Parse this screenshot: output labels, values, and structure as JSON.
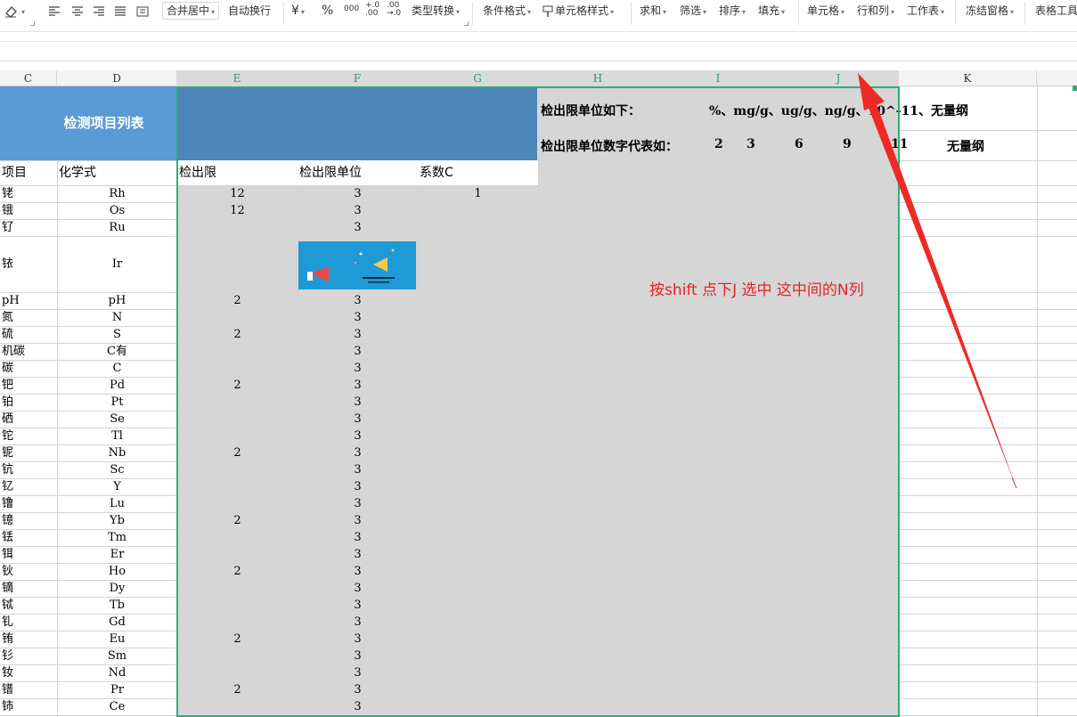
{
  "toolbar": {
    "merge_center": "合并居中",
    "wrap_text": "自动换行",
    "currency_symbol": "¥",
    "percent_symbol": "%",
    "thousands_symbol": "000",
    "inc_decimal": "+.0\n.00",
    "dec_decimal": ".00\n→.0",
    "type_convert": "类型转换",
    "conditional_format": "条件格式",
    "cell_style": "单元格样式",
    "sum": "求和",
    "filter": "筛选",
    "sort": "排序",
    "fill": "填充",
    "cell": "单元格",
    "row_col": "行和列",
    "worksheet": "工作表",
    "freeze": "冻结窗格",
    "table_tools": "表格工具"
  },
  "columns": [
    "C",
    "D",
    "E",
    "F",
    "G",
    "H",
    "I",
    "J",
    "K"
  ],
  "sheet": {
    "title": "检测项目列表",
    "unit_line1_label": "检出限单位如下：",
    "unit_line1_values": "%、mg/g、ug/g、ng/g、10^-11、无量纲",
    "unit_line2_label": "检出限单位数字代表如：",
    "unit_line2_values": [
      "2",
      "3",
      "6",
      "9",
      "11",
      "无量纲"
    ],
    "headers": {
      "c": "项目",
      "d": "化学式",
      "e": "检出限",
      "f": "检出限单位",
      "g": "系数C"
    },
    "rows": [
      {
        "c": "铑",
        "d": "Rh",
        "e": "12",
        "f": "3",
        "g": "1"
      },
      {
        "c": "锇",
        "d": "Os",
        "e": "12",
        "f": "3",
        "g": ""
      },
      {
        "c": "钌",
        "d": "Ru",
        "e": "",
        "f": "3",
        "g": ""
      },
      {
        "c": "铱",
        "d": "Ir",
        "e": "",
        "f": "",
        "g": ""
      },
      {
        "c": "pH",
        "d": "pH",
        "e": "2",
        "f": "3",
        "g": ""
      },
      {
        "c": "氮",
        "d": "N",
        "e": "",
        "f": "3",
        "g": ""
      },
      {
        "c": "硫",
        "d": "S",
        "e": "2",
        "f": "3",
        "g": ""
      },
      {
        "c": "机碳",
        "d": "C有",
        "e": "",
        "f": "3",
        "g": ""
      },
      {
        "c": "碳",
        "d": "C",
        "e": "",
        "f": "3",
        "g": ""
      },
      {
        "c": "钯",
        "d": "Pd",
        "e": "2",
        "f": "3",
        "g": ""
      },
      {
        "c": "铂",
        "d": "Pt",
        "e": "",
        "f": "3",
        "g": ""
      },
      {
        "c": "硒",
        "d": "Se",
        "e": "",
        "f": "3",
        "g": ""
      },
      {
        "c": "铊",
        "d": "Tl",
        "e": "",
        "f": "3",
        "g": ""
      },
      {
        "c": "铌",
        "d": "Nb",
        "e": "2",
        "f": "3",
        "g": ""
      },
      {
        "c": "钪",
        "d": "Sc",
        "e": "",
        "f": "3",
        "g": ""
      },
      {
        "c": "钇",
        "d": "Y",
        "e": "",
        "f": "3",
        "g": ""
      },
      {
        "c": "镥",
        "d": "Lu",
        "e": "",
        "f": "3",
        "g": ""
      },
      {
        "c": "镱",
        "d": "Yb",
        "e": "2",
        "f": "3",
        "g": ""
      },
      {
        "c": "铥",
        "d": "Tm",
        "e": "",
        "f": "3",
        "g": ""
      },
      {
        "c": "铒",
        "d": "Er",
        "e": "",
        "f": "3",
        "g": ""
      },
      {
        "c": "钬",
        "d": "Ho",
        "e": "2",
        "f": "3",
        "g": ""
      },
      {
        "c": "镝",
        "d": "Dy",
        "e": "",
        "f": "3",
        "g": ""
      },
      {
        "c": "铽",
        "d": "Tb",
        "e": "",
        "f": "3",
        "g": ""
      },
      {
        "c": "钆",
        "d": "Gd",
        "e": "",
        "f": "3",
        "g": ""
      },
      {
        "c": "铕",
        "d": "Eu",
        "e": "2",
        "f": "3",
        "g": ""
      },
      {
        "c": "钐",
        "d": "Sm",
        "e": "",
        "f": "3",
        "g": ""
      },
      {
        "c": "钕",
        "d": "Nd",
        "e": "",
        "f": "3",
        "g": ""
      },
      {
        "c": "镨",
        "d": "Pr",
        "e": "2",
        "f": "3",
        "g": ""
      },
      {
        "c": "铈",
        "d": "Ce",
        "e": "",
        "f": "3",
        "g": ""
      }
    ]
  },
  "annotation": "按shift 点下J  选中 这中间的N列",
  "colors": {
    "selection_border": "#2fae74",
    "title_bg": "#5b9bd5",
    "annotation": "#e8231f"
  }
}
